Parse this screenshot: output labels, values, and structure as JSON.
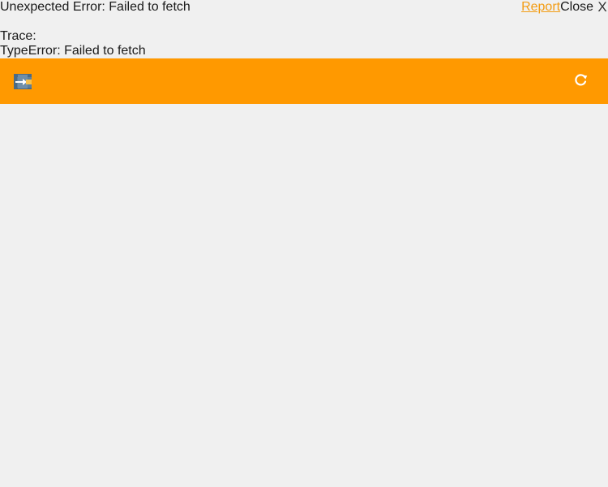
{
  "error": {
    "message": "Unexpected Error: Failed to fetch",
    "report_label": "Report",
    "close_label": "Close",
    "close_icon": "X",
    "trace_label": "Trace:",
    "trace_text": "TypeError: Failed to fetch"
  },
  "toolbar": {
    "background_color": "#ff9900",
    "left_icon": "logout-icon",
    "right_icon": "refresh-icon"
  },
  "colors": {
    "page_background": "#f0f0f0",
    "report_link": "#f39c12",
    "toolbar": "#ff9900"
  }
}
